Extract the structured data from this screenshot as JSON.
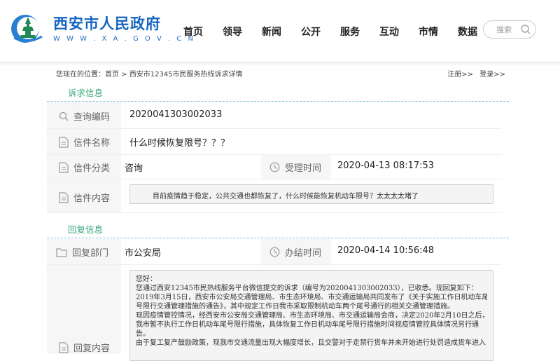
{
  "header": {
    "site_title": "西安市人民政府",
    "site_url": "W W W . X A . G O V . C N",
    "nav": [
      "首页",
      "领导",
      "新闻",
      "公开",
      "服务",
      "互动",
      "市情",
      "数据"
    ],
    "search_placeholder": "搜索"
  },
  "breadcrumb": {
    "text": "您现在的位置：首页 > 西安市12345市民服务热线诉求详情",
    "register": "注册>>",
    "login": "登录>>"
  },
  "appeal": {
    "section_title": "诉求信息",
    "query_code_label": "查询编码",
    "query_code": "2020041303002033",
    "letter_name_label": "信件名称",
    "letter_name": "什么时候恢复限号？？？",
    "category_label": "信件分类",
    "category": "咨询",
    "accept_time_label": "受理时间",
    "accept_time": "2020-04-13 08:17:53",
    "content_label": "信件内容",
    "content": "目前疫情趋于稳定，公共交通也都恢复了，什么时候能恢复机动车限号？太太太太堵了"
  },
  "reply": {
    "section_title": "回复信息",
    "dept_label": "回复部门",
    "dept": "市公安局",
    "done_time_label": "办结时间",
    "done_time": "2020-04-14 10:56:48",
    "content_label": "回复内容",
    "lines": [
      "您好：",
      "您通过西安12345市民热线服务平台微信提交的诉求（编号为2020041303002033），已收悉。现回复如下：",
      "2019年3月15日，西安市公安局交通管理局、市生态环境局、市交通运输局共同发布了《关于实施工作日机动车尾",
      "号限行交通管理措施的通告》，其中规定工作日我市采取限制机动车两个尾号通行的相关交通管理措施。",
      "现因疫情管控情况，经西安市公安局交通管理局、市生态环境局、市交通运输局会商，决定2020年2月10日之后，",
      "我市暂不执行工作日机动车尾号限行措施，具体恢复工作日机动车尾号限行措施时间视疫情管控具体情况另行通",
      "告。",
      "由于复工复产鼓励政策，现我市交通流量出现大幅度增长，且交警对于走禁行货车并未开始进行处罚造成货车进入"
    ]
  }
}
